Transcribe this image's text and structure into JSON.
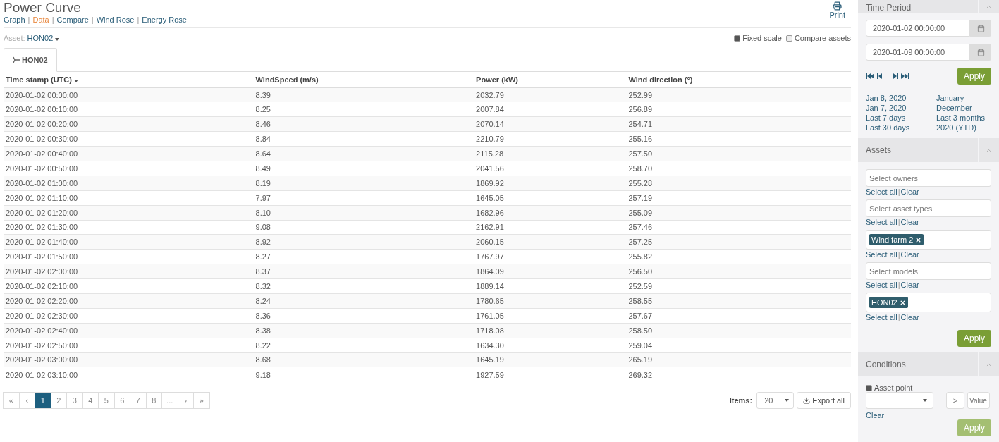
{
  "title": "Power Curve",
  "views": [
    {
      "label": "Graph",
      "selected": false
    },
    {
      "label": "Data",
      "selected": true
    },
    {
      "label": "Compare",
      "selected": false
    },
    {
      "label": "Wind Rose",
      "selected": false
    },
    {
      "label": "Energy Rose",
      "selected": false
    }
  ],
  "view_separator": "|",
  "print": "Print",
  "asset": {
    "label": "Asset:",
    "value": "HON02"
  },
  "options": [
    {
      "label": "Fixed scale",
      "checked": true
    },
    {
      "label": "Compare assets",
      "checked": false
    }
  ],
  "tabs": [
    {
      "label": "HON02",
      "selected": true
    }
  ],
  "table": {
    "columns": [
      {
        "label": "Time stamp (UTC)",
        "sorted": true
      },
      {
        "label": "WindSpeed (m/s)",
        "sorted": false
      },
      {
        "label": "Power (kW)",
        "sorted": false
      },
      {
        "label": "Wind direction (°)",
        "sorted": false
      }
    ],
    "rows": [
      [
        "2020-01-02 00:00:00",
        "8.39",
        "2032.79",
        "252.99"
      ],
      [
        "2020-01-02 00:10:00",
        "8.25",
        "2007.84",
        "256.89"
      ],
      [
        "2020-01-02 00:20:00",
        "8.46",
        "2070.14",
        "254.71"
      ],
      [
        "2020-01-02 00:30:00",
        "8.84",
        "2210.79",
        "255.16"
      ],
      [
        "2020-01-02 00:40:00",
        "8.64",
        "2115.28",
        "257.50"
      ],
      [
        "2020-01-02 00:50:00",
        "8.49",
        "2041.56",
        "258.70"
      ],
      [
        "2020-01-02 01:00:00",
        "8.19",
        "1869.92",
        "255.28"
      ],
      [
        "2020-01-02 01:10:00",
        "7.97",
        "1645.05",
        "257.19"
      ],
      [
        "2020-01-02 01:20:00",
        "8.10",
        "1682.96",
        "255.09"
      ],
      [
        "2020-01-02 01:30:00",
        "9.08",
        "2162.91",
        "257.46"
      ],
      [
        "2020-01-02 01:40:00",
        "8.92",
        "2060.15",
        "257.25"
      ],
      [
        "2020-01-02 01:50:00",
        "8.27",
        "1767.97",
        "255.82"
      ],
      [
        "2020-01-02 02:00:00",
        "8.37",
        "1864.09",
        "256.50"
      ],
      [
        "2020-01-02 02:10:00",
        "8.32",
        "1889.14",
        "252.59"
      ],
      [
        "2020-01-02 02:20:00",
        "8.24",
        "1780.65",
        "258.55"
      ],
      [
        "2020-01-02 02:30:00",
        "8.36",
        "1761.05",
        "257.67"
      ],
      [
        "2020-01-02 02:40:00",
        "8.38",
        "1718.08",
        "258.50"
      ],
      [
        "2020-01-02 02:50:00",
        "8.22",
        "1634.30",
        "259.04"
      ],
      [
        "2020-01-02 03:00:00",
        "8.68",
        "1645.19",
        "265.19"
      ],
      [
        "2020-01-02 03:10:00",
        "9.18",
        "1927.59",
        "269.32"
      ]
    ]
  },
  "pagination": [
    {
      "label": "«",
      "selected": false
    },
    {
      "label": "‹",
      "selected": false
    },
    {
      "label": "1",
      "selected": true
    },
    {
      "label": "2",
      "selected": false
    },
    {
      "label": "3",
      "selected": false
    },
    {
      "label": "4",
      "selected": false
    },
    {
      "label": "5",
      "selected": false
    },
    {
      "label": "6",
      "selected": false
    },
    {
      "label": "7",
      "selected": false
    },
    {
      "label": "8",
      "selected": false
    },
    {
      "label": "...",
      "selected": false
    },
    {
      "label": "›",
      "selected": false
    },
    {
      "label": "»",
      "selected": false
    }
  ],
  "items": {
    "label": "Items:",
    "value": "20"
  },
  "export": "Export all",
  "sidebar": {
    "time_period": {
      "title": "Time Period",
      "from": "2020-01-02 00:00:00",
      "to": "2020-01-09 00:00:00",
      "apply": "Apply",
      "quick": [
        "Jan 8, 2020",
        "January",
        "Jan 7, 2020",
        "December",
        "Last 7 days",
        "Last 3 months",
        "Last 30 days",
        "2020 (YTD)"
      ]
    },
    "assets": {
      "title": "Assets",
      "separator": "|",
      "filters": [
        {
          "kind": "placeholder",
          "placeholder": "Select owners",
          "select_all": "Select all",
          "clear": "Clear"
        },
        {
          "kind": "placeholder",
          "placeholder": "Select asset types",
          "select_all": "Select all",
          "clear": "Clear"
        },
        {
          "kind": "tags",
          "tags": [
            "Wind farm 2"
          ],
          "select_all": "Select all",
          "clear": "Clear"
        },
        {
          "kind": "placeholder",
          "placeholder": "Select models",
          "select_all": "Select all",
          "clear": "Clear"
        },
        {
          "kind": "tags",
          "tags": [
            "HON02"
          ],
          "select_all": "Select all",
          "clear": "Clear"
        }
      ],
      "apply": "Apply"
    },
    "conditions": {
      "title": "Conditions",
      "asset_point": {
        "label": "Asset point",
        "checked": true
      },
      "operator": ">",
      "value_placeholder": "Value",
      "clear": "Clear",
      "apply": {
        "label": "Apply",
        "disabled": true
      }
    }
  }
}
